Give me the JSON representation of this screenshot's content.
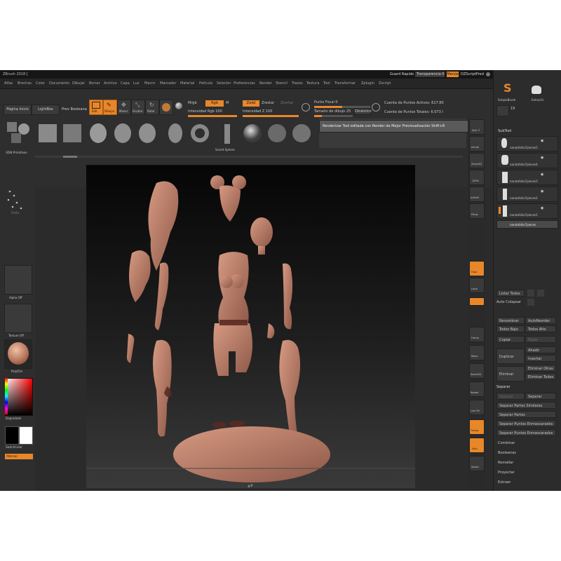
{
  "window": {
    "title": "ZBrush 2018 [",
    "quick_save": "Guard Rapido",
    "transparency_label": "Transparencia 0",
    "menus_button": "Menús",
    "default_zscript": "DZScriptPred"
  },
  "menubar": [
    "Alfas",
    "Brochas",
    "Color",
    "Documento",
    "Dibujar",
    "Borrar",
    "Archivo",
    "Capa",
    "Luz",
    "Macro",
    "Marcador",
    "Material",
    "Película",
    "Selector",
    "Preferencias",
    "Render",
    "Stencil",
    "Trazos",
    "Textura",
    "Tool",
    "Transformar",
    "Zplugin",
    "Zscript"
  ],
  "shelf": {
    "home_page": "Página Inicio",
    "lightbox": "LightBox",
    "live_boolean": "Prev Booleana",
    "edit": "Edit",
    "draw": "Dibujar",
    "move": "Mover",
    "scale": "Escalar",
    "rotate": "Rotar",
    "mrgb": "Mrgb",
    "rgb": "Rgb",
    "m": "M",
    "zadd": "Zadd",
    "zsub": "Zrestar",
    "zcut": "Zcortar",
    "rgb_intensity": "Intensidad Rgb 100",
    "z_intensity": "Intensidad Z 100",
    "focal_shift": "Punto Focal 0",
    "draw_size": "Tamaño de dibujo 25",
    "dynamic": "Dinámico",
    "active_points": "Cuenta de Puntos Activos: 617.80",
    "total_points": "Cuenta de Puntos Totales: 6.073 I",
    "tooltip": "Renderizar Tool editada con Render de Mejor Previsualización  Shift+R",
    "primitive_label": "Sxsmt Sphere",
    "rotate_button": "Rotar"
  },
  "left": {
    "primitives": "3DW Primitivas",
    "dots": "Dots",
    "alpha": "Alpha Off",
    "texture": "Texture Off",
    "material": "PolyFilm",
    "gradient": "Degradado",
    "switch_color": "SwitchColor",
    "alternate": "Alternar"
  },
  "right_panel": {
    "simplebrush": "SimpleBrush",
    "extract": "Extract3",
    "count": "19",
    "subtool_title": "SubTool",
    "subtools": [
      "narutofolio7pieces5",
      "narutofolio7pieces4",
      "narutofolio7pieces3",
      "narutofolio7pieces2",
      "narutofolio7pieces1"
    ],
    "active_subtool": "narutofolio7pieces",
    "list_all": "Listar Todos",
    "auto_collapse": "Auto Colapsar",
    "rename": "Renombrar",
    "autoreorder": "AutoReorder",
    "all_low": "Todos Bajo",
    "all_high": "Todos Alto",
    "copy": "Copiar",
    "paste": "Pegar",
    "duplicate": "Duplicar",
    "append": "Añadir",
    "insert": "Insertar",
    "delete": "Eliminar",
    "delete_other": "Eliminar Otras",
    "delete_all": "Eliminar Todas",
    "split_title": "Separar",
    "split_hidden": "Separar Ocultos",
    "split_groups": "Separar Grupos",
    "split_similar": "Separar Partes Similares",
    "split_parts": "Separar Partes",
    "split_unmasked": "Separar Puntos Enmascarados",
    "split_masked": "Separar Puntos Enmascarados",
    "merge": "Combinar",
    "boolean": "Booleanas",
    "remesh": "Remallar",
    "project": "Proyectar",
    "extract_label": "Extraer"
  },
  "right_toolbar": [
    "Spix 3",
    "Actual",
    "Zoom2D",
    "100%",
    "AAHalf",
    "Persp",
    "Floor",
    "Local",
    "Frame",
    "Move",
    "Zoom3D",
    "Rotate",
    "Line Fill",
    "Transp",
    "Solo",
    "Xpose"
  ],
  "colors": {
    "accent": "#e8872a",
    "clay": "#c98a70",
    "background": "#2b2b2b"
  }
}
